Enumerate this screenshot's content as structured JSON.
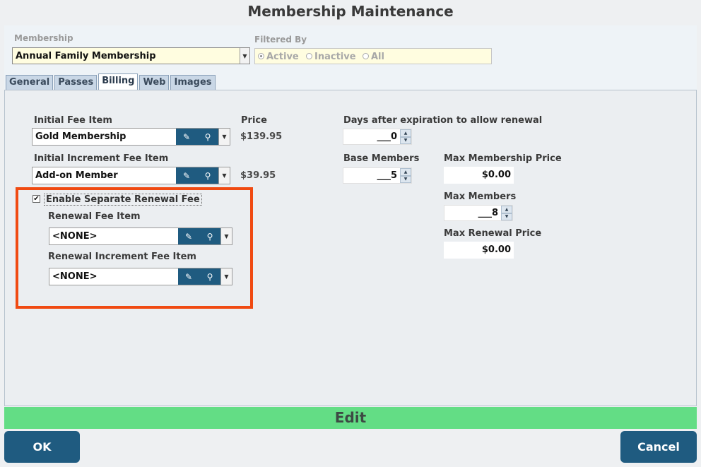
{
  "window": {
    "title": "Membership Maintenance"
  },
  "membership": {
    "label": "Membership",
    "value": "Annual Family Membership"
  },
  "filter": {
    "label": "Filtered By",
    "options": [
      {
        "label": "Active",
        "selected": true
      },
      {
        "label": "Inactive",
        "selected": false
      },
      {
        "label": "All",
        "selected": false
      }
    ]
  },
  "tabs": [
    {
      "label": "General",
      "active": false
    },
    {
      "label": "Passes",
      "active": false
    },
    {
      "label": "Billing",
      "active": true
    },
    {
      "label": "Web",
      "active": false
    },
    {
      "label": "Images",
      "active": false
    }
  ],
  "billing": {
    "initial_fee": {
      "label": "Initial Fee Item",
      "value": "Gold Membership",
      "price": "$139.95"
    },
    "price_label": "Price",
    "increment_fee": {
      "label": "Initial Increment Fee Item",
      "value": "Add-on Member",
      "price": "$39.95"
    },
    "enable_renewal": {
      "label": "Enable Separate Renewal Fee",
      "checked": true,
      "mark": "✔"
    },
    "renewal_fee": {
      "label": "Renewal Fee Item",
      "value": "<NONE>"
    },
    "renewal_increment": {
      "label": "Renewal Increment Fee Item",
      "value": "<NONE>"
    },
    "days_after": {
      "label": "Days after expiration to allow renewal",
      "value": "___0"
    },
    "base_members": {
      "label": "Base Members",
      "value": "___5"
    },
    "max_price": {
      "label": "Max Membership Price",
      "value": "$0.00"
    },
    "max_members": {
      "label": "Max Members",
      "value": "___8"
    },
    "max_renewal": {
      "label": "Max Renewal Price",
      "value": "$0.00"
    }
  },
  "mode_label": "Edit",
  "buttons": {
    "ok": "OK",
    "cancel": "Cancel"
  },
  "colors": {
    "accent": "#1f5b80",
    "edit_bar": "#63dd85",
    "highlight": "#f04a12"
  }
}
